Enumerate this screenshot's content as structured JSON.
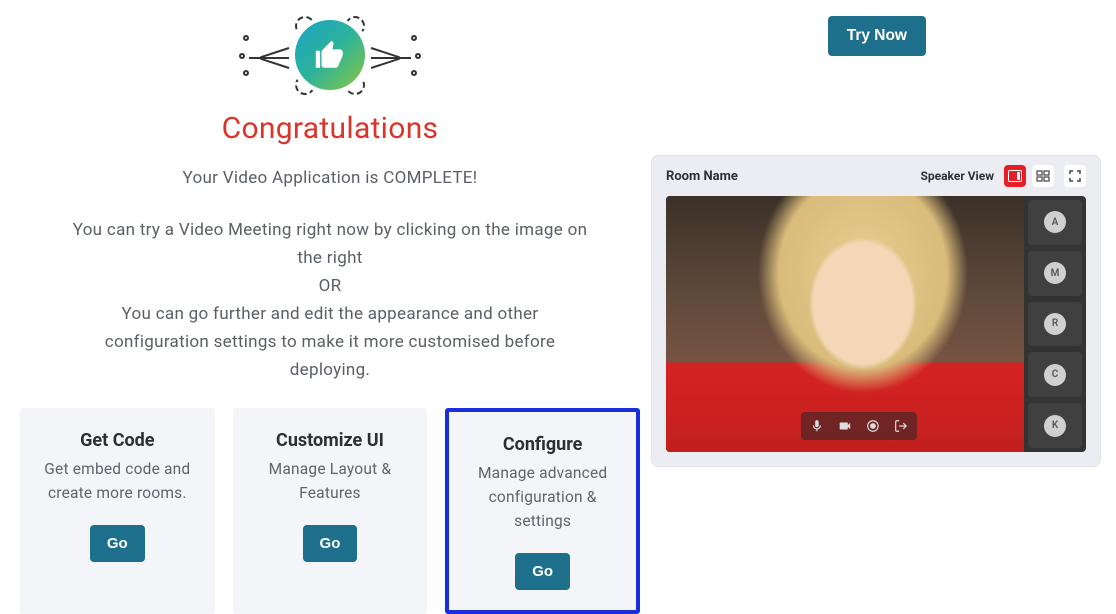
{
  "header": {
    "try_now": "Try Now"
  },
  "hero": {
    "title": "Congratulations",
    "subtitle": "Your Video Application is COMPLETE!",
    "instr_line1": "You can try a Video Meeting right now by clicking on the image on the right",
    "instr_or": "OR",
    "instr_line2": "You can go further and edit the appearance and other configuration settings to make it more customised before deploying."
  },
  "cards": [
    {
      "title": "Get Code",
      "desc": "Get embed code and create more rooms.",
      "btn": "Go"
    },
    {
      "title": "Customize UI",
      "desc": "Manage Layout & Features",
      "btn": "Go"
    },
    {
      "title": "Configure",
      "desc": "Manage advanced configuration & settings",
      "btn": "Go"
    }
  ],
  "video": {
    "room_name": "Room Name",
    "speaker_view": "Speaker View",
    "participants": [
      "A",
      "M",
      "R",
      "C",
      "K"
    ]
  }
}
